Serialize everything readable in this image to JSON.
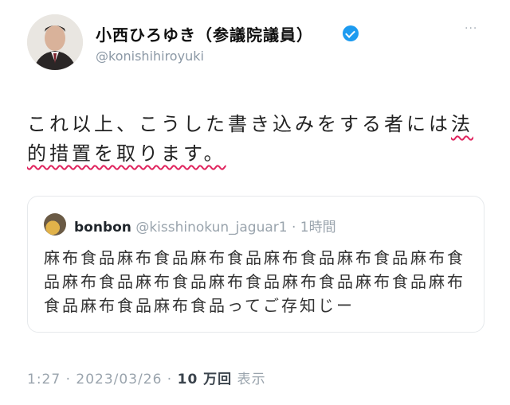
{
  "author": {
    "display_name": "小西ひろゆき（参議院議員）",
    "handle": "@konishihiroyuki",
    "avatar_icon": "person-portrait-icon",
    "verified_icon": "verified-badge-icon",
    "more_icon": "more-options-icon"
  },
  "tweet": {
    "text_plain": "これ以上、こうした書き込みをする者には",
    "text_highlight": "法的措置を取ります。"
  },
  "quote": {
    "name": "bonbon",
    "handle": "@kisshinokun_jaguar1",
    "time": "· 1時間",
    "text": "麻布食品麻布食品麻布食品麻布食品麻布食品麻布食品麻布食品麻布食品麻布食品麻布食品麻布食品麻布食品麻布食品麻布食品ってご存知じー"
  },
  "footer": {
    "time": "1:27",
    "date": "2023/03/26",
    "views_count": "10 万回",
    "views_label": "表示"
  },
  "colors": {
    "accent": "#1d9bf0",
    "underline": "#e0245e"
  }
}
